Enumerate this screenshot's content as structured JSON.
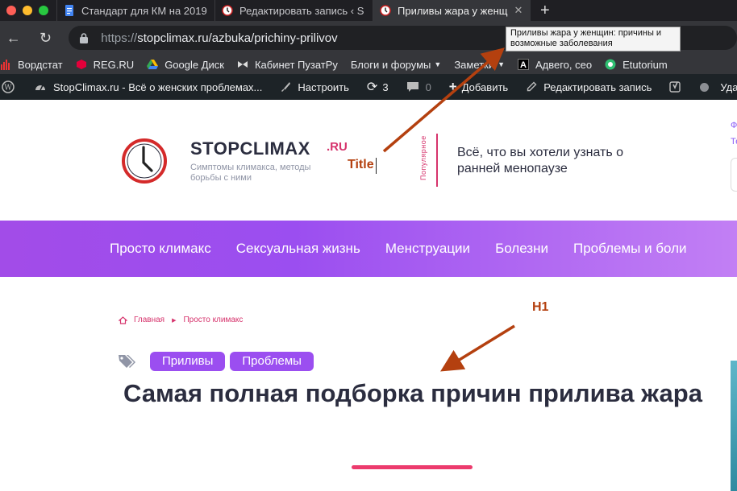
{
  "tabs": [
    {
      "title": "Стандарт для КМ на 2019",
      "icon": "google-docs-icon"
    },
    {
      "title": "Редактировать запись ‹ S",
      "icon": "clock-icon"
    },
    {
      "title": "Приливы жара у женщ",
      "icon": "clock-icon",
      "active": true
    }
  ],
  "address": {
    "proto": "https://",
    "rest": "stopclimax.ru/azbuka/prichiny-prilivov"
  },
  "tooltip": "Приливы жара у женщин: причины и возможные заболевания",
  "bookmarks": [
    {
      "label": "Вордстат",
      "icon": "chart-icon"
    },
    {
      "label": "REG.RU",
      "icon": "cube-icon"
    },
    {
      "label": "Google Диск",
      "icon": "drive-icon"
    },
    {
      "label": "Кабинет ПузатРу",
      "icon": "bow-icon"
    },
    {
      "label": "Блоги и форумы",
      "icon": "folder-icon",
      "dropdown": true
    },
    {
      "label": "Заметки",
      "icon": "folder-icon",
      "dropdown": true
    },
    {
      "label": "Адвего, сео",
      "icon": "a-icon"
    },
    {
      "label": "Etutorium",
      "icon": "etutorium-icon"
    }
  ],
  "wpbar": {
    "site": "StopClimax.ru - Всё о женских проблемах...",
    "customize": "Настроить",
    "updates": "3",
    "comments": "0",
    "add": "Добавить",
    "edit": "Редактировать запись",
    "howdy": "Уда"
  },
  "site": {
    "brand": "STOPCLIMAX",
    "brand_suffix": ".RU",
    "tagline": "Симптомы климакса, методы борьбы с ними",
    "popular_label": "Популярное",
    "promo": "Всё, что вы хотели узнать о ранней менопаузе",
    "right_links": [
      "Ф",
      "Те"
    ]
  },
  "menu": [
    "Просто климакс",
    "Сексуальная жизнь",
    "Менструации",
    "Болезни",
    "Проблемы и боли"
  ],
  "breadcrumb": [
    "Главная",
    "Просто климакс"
  ],
  "tags": [
    "Приливы",
    "Проблемы"
  ],
  "h1": "Самая полная подборка причин прилива жара",
  "annotations": {
    "title": "Title",
    "h1": "H1"
  },
  "colors": {
    "accent": "#9b4ef0",
    "pink": "#d6336c",
    "annotation": "#b4400f",
    "text": "#2b2d3f"
  }
}
